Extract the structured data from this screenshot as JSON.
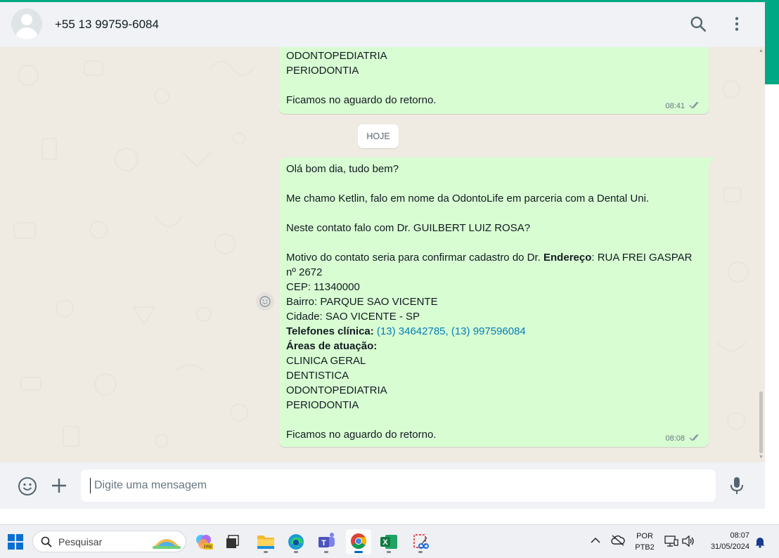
{
  "header": {
    "contact_name": "+55 13 99759-6084",
    "icons": [
      "search-icon",
      "menu-icon"
    ]
  },
  "chat": {
    "date_chip": "HOJE",
    "messages": [
      {
        "lines": [
          "ODONTOPEDIATRIA",
          "PERIODONTIA",
          "",
          "Ficamos no aguardo do retorno."
        ],
        "time": "08:41",
        "status": "delivered"
      },
      {
        "greeting": "Olá bom dia, tudo bem?",
        "intro": "Me chamo Ketlin, falo em nome da OdontoLife em parceria com a Dental Uni.",
        "question": "Neste contato falo com Dr. GUILBERT LUIZ ROSA?",
        "motivo_prefix": "Motivo do contato seria para confirmar cadastro do Dr. ",
        "endereco_label": "Endereço",
        "endereco_value": ": RUA FREI GASPAR",
        "endereco_cont": "nº 2672",
        "cep": "CEP: 11340000",
        "bairro": "Bairro: PARQUE SAO VICENTE",
        "cidade": "Cidade: SAO VICENTE - SP",
        "telefones_label": "Telefones clínica:",
        "telefones_links": " (13) 34642785, (13) 997596084",
        "areas_label": "Áreas de atuação:",
        "areas": [
          "CLINICA GERAL",
          "DENTISTICA",
          "ODONTOPEDIATRIA",
          "PERIODONTIA"
        ],
        "closing": "Ficamos no aguardo do retorno.",
        "time": "08:08",
        "status": "delivered"
      }
    ]
  },
  "composer": {
    "placeholder": "Digite uma mensagem",
    "icons": [
      "emoji-icon",
      "plus-icon",
      "microphone-icon"
    ]
  },
  "taskbar": {
    "search_label": "Pesquisar",
    "apps": [
      "copilot-icon",
      "task-view-icon",
      "file-explorer-icon",
      "edge-icon",
      "teams-icon",
      "chrome-icon",
      "excel-icon",
      "snipping-tool-icon"
    ],
    "language_top": "POR",
    "language_bottom": "PTB2",
    "time": "08:07",
    "date": "31/05/2024"
  },
  "colors": {
    "accent": "#00a884",
    "bubble_out": "#d9fdd3",
    "chat_bg": "#efeae2",
    "header_bg": "#f0f2f5",
    "link": "#027eb5"
  }
}
